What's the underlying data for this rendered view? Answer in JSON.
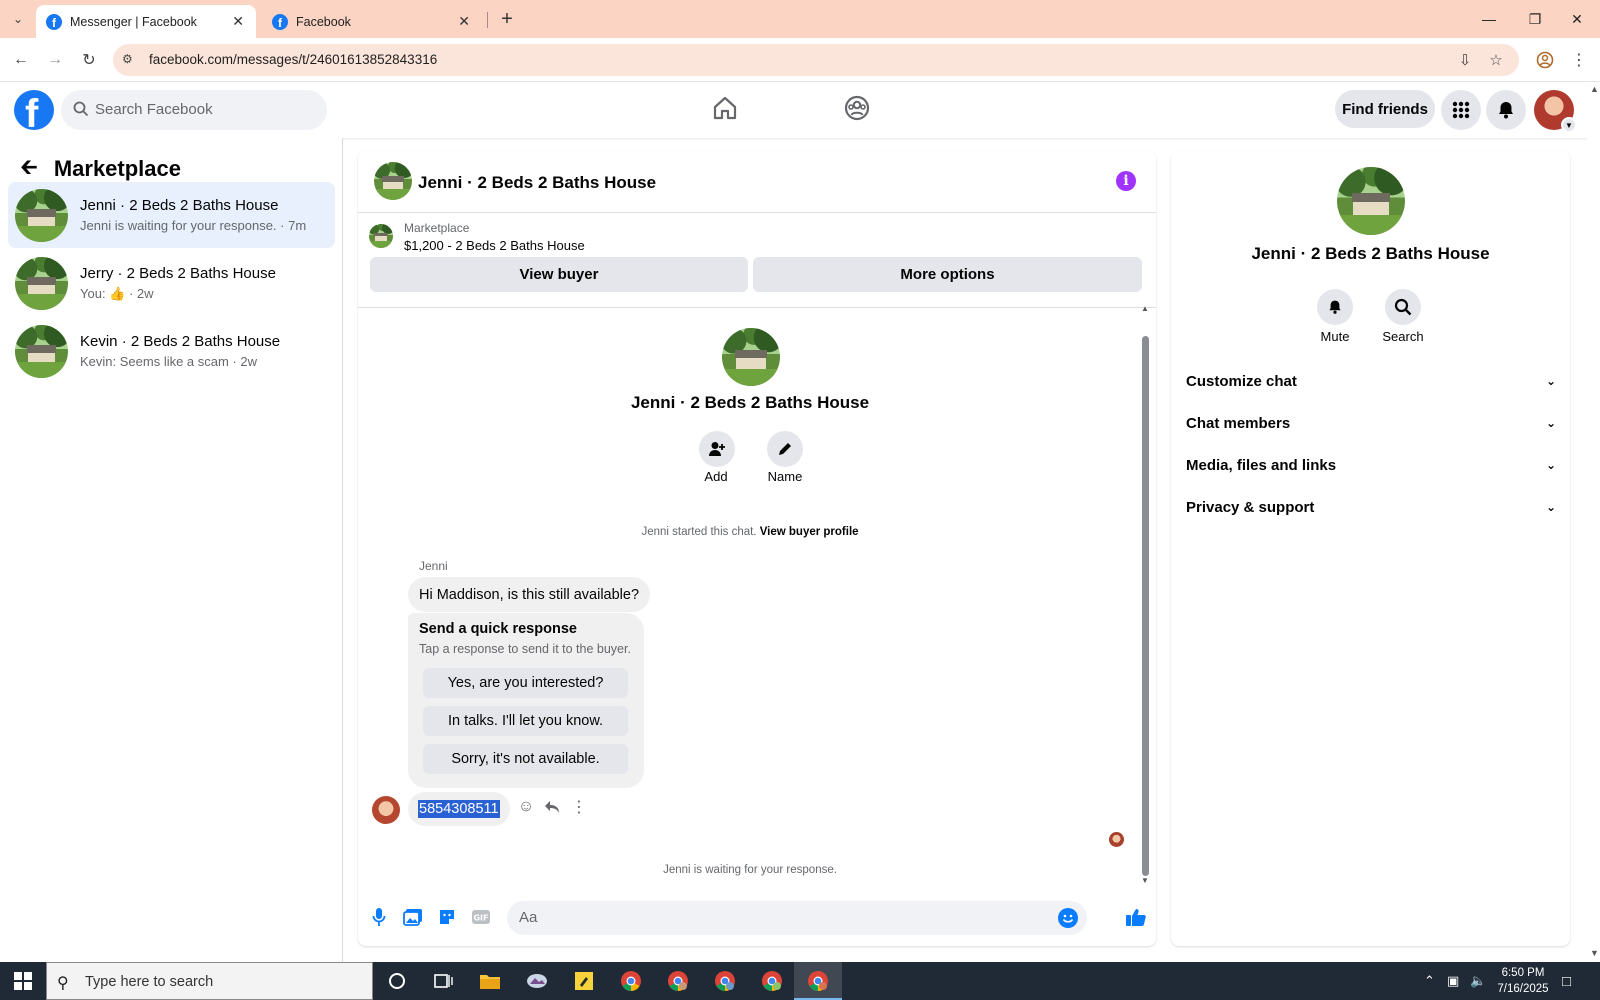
{
  "browser": {
    "tabs": [
      {
        "title": "Messenger | Facebook",
        "active": true
      },
      {
        "title": "Facebook",
        "active": false
      }
    ],
    "url": "facebook.com/messages/t/24601613852843316"
  },
  "fb_header": {
    "search_placeholder": "Search Facebook",
    "find_friends": "Find friends"
  },
  "sidebar": {
    "title": "Marketplace",
    "conversations": [
      {
        "title": "Jenni · 2 Beds 2 Baths House",
        "subtitle": "Jenni is waiting for your response. · 7m",
        "active": true
      },
      {
        "title": "Jerry · 2 Beds 2 Baths House",
        "subtitle_prefix": "You: ",
        "subtitle_suffix": " · 2w",
        "active": false
      },
      {
        "title": "Kevin · 2 Beds 2 Baths House",
        "subtitle": "Kevin: Seems like a scam · 2w",
        "active": false
      }
    ]
  },
  "chat": {
    "title": "Jenni · 2 Beds 2 Baths House",
    "listing": {
      "label": "Marketplace",
      "title": "$1,200 - 2 Beds 2 Baths House",
      "view_buyer": "View buyer",
      "more_options": "More options"
    },
    "profile": {
      "name": "Jenni · 2 Beds 2 Baths House",
      "add_label": "Add",
      "name_label": "Name"
    },
    "started_text": "Jenni started this chat.",
    "view_buyer_profile": "View buyer profile",
    "sender": "Jenni",
    "message": "Hi Maddison, is this still available?",
    "quick_response": {
      "title": "Send a quick response",
      "subtitle": "Tap a response to send it to the buyer.",
      "options": [
        "Yes, are you interested?",
        "In talks. I'll let you know.",
        "Sorry, it's not available."
      ]
    },
    "phone_message": "5854308511",
    "waiting_text": "Jenni is waiting for your response.",
    "composer_placeholder": "Aa"
  },
  "right_panel": {
    "name": "Jenni · 2 Beds 2 Baths House",
    "mute_label": "Mute",
    "search_label": "Search",
    "sections": [
      "Customize chat",
      "Chat members",
      "Media, files and links",
      "Privacy & support"
    ]
  },
  "taskbar": {
    "search_placeholder": "Type here to search",
    "time": "6:50 PM",
    "date": "7/16/2025"
  },
  "colors": {
    "fb_blue": "#1877f2",
    "tabbar": "#fbd4c4",
    "selected_conv": "#e7f0fc",
    "info_purple": "#a033ff"
  }
}
